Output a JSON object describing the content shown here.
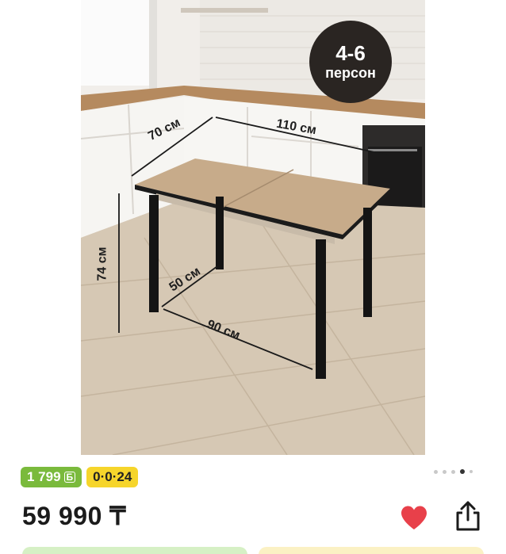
{
  "product_image": {
    "badge_count": "4-6",
    "badge_unit": "персон",
    "dimensions": {
      "depth_top": "70 см",
      "length_top": "110 см",
      "height": "74 см",
      "depth_base": "50 см",
      "length_base": "90 см"
    },
    "carousel": {
      "total": 5,
      "active_index": 3
    }
  },
  "bonus": {
    "amount": "1 799",
    "currency_symbol": "Б"
  },
  "installment": {
    "label": "0·0·24"
  },
  "price": {
    "text": "59 990 ₸"
  },
  "actions": {
    "favorite_icon": "heart-icon",
    "share_icon": "share-icon",
    "favorite_color": "#e8404a"
  },
  "colors": {
    "bonus_green": "#7aba3c",
    "installment_yellow": "#f6d52b"
  }
}
